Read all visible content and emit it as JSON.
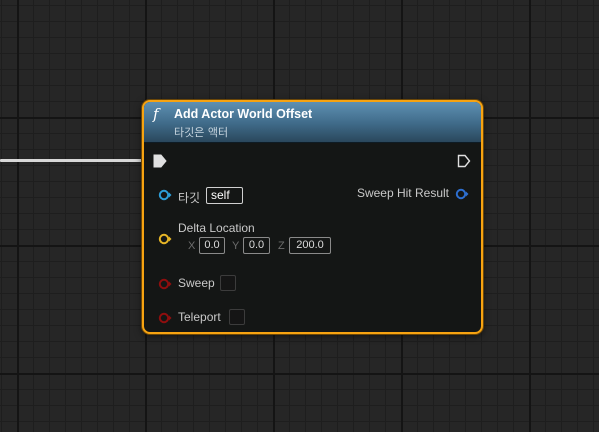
{
  "node": {
    "function_icon": "f",
    "title": "Add Actor World Offset",
    "target_subtitle": "타깃은 액터"
  },
  "pins": {
    "exec_in": {
      "icon": "exec-in-pin-icon",
      "connected": true
    },
    "exec_out": {
      "icon": "exec-out-pin-icon",
      "connected": false
    },
    "target": {
      "label": "타깃",
      "value": "self",
      "color": "#2d9ed8"
    },
    "sweep_hit_result": {
      "label": "Sweep Hit Result",
      "color": "#2d6fd0"
    },
    "delta_location": {
      "label": "Delta Location",
      "color": "#e6b526",
      "x_label": "X",
      "x": "0.0",
      "y_label": "Y",
      "y": "0.0",
      "z_label": "Z",
      "z": "200.0"
    },
    "sweep": {
      "label": "Sweep",
      "checked": false,
      "color": "#8f0e0e"
    },
    "teleport": {
      "label": "Teleport",
      "checked": false,
      "color": "#8f0e0e"
    }
  },
  "colors": {
    "selection_outline": "#f7a311",
    "header_top": "#5e90b3",
    "header_bottom": "#2a475c",
    "wire": "#d8d8d8"
  }
}
